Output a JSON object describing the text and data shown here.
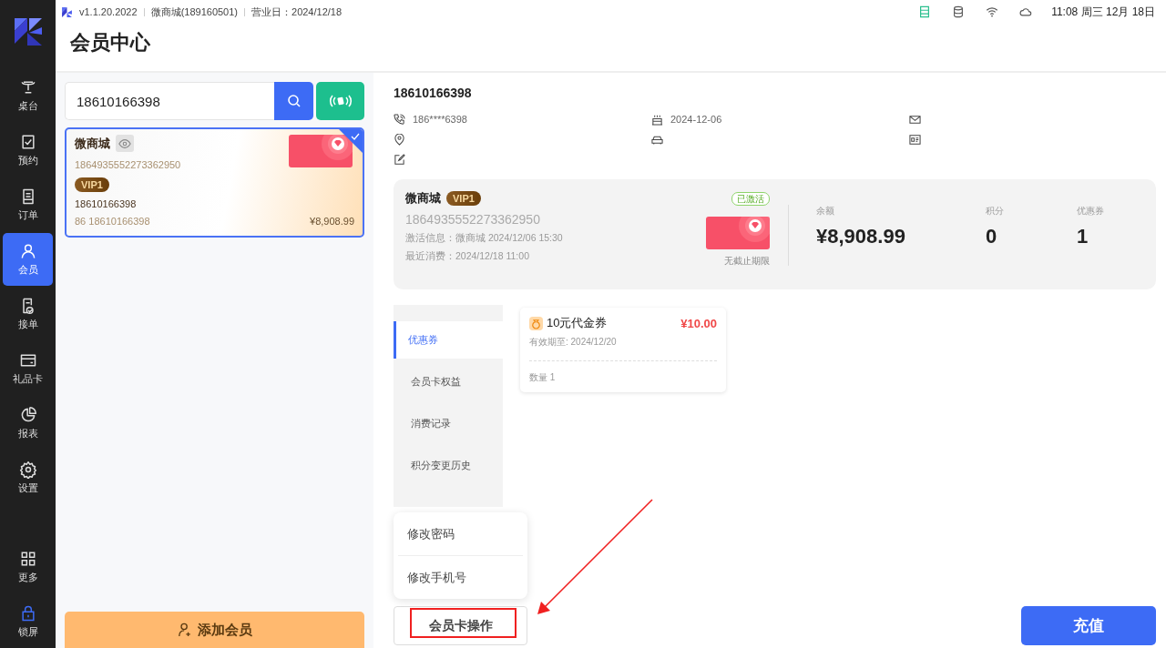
{
  "app_bar": {
    "version": "v1.1.20.2022",
    "store": "微商城(189160501)",
    "business_day": "营业日：2024/12/18",
    "clock": "11:08 周三 12月 18日"
  },
  "page_title": "会员中心",
  "sidebar": {
    "items": [
      {
        "label": "桌台",
        "selected": false
      },
      {
        "label": "预约",
        "selected": false
      },
      {
        "label": "订单",
        "selected": false
      },
      {
        "label": "会员",
        "selected": true
      },
      {
        "label": "接单",
        "selected": false
      },
      {
        "label": "礼品卡",
        "selected": false
      },
      {
        "label": "报表",
        "selected": false
      },
      {
        "label": "设置",
        "selected": false
      }
    ],
    "bottom_items": [
      {
        "label": "更多",
        "selected": false
      },
      {
        "label": "锁屏",
        "selected": false
      }
    ]
  },
  "search": {
    "value": "18610166398"
  },
  "member_cards": [
    {
      "name": "微商城",
      "card_no": "1864935552273362950",
      "level": "VIP1",
      "phone": "18610166398",
      "phone_full": "86 18610166398",
      "balance": "¥8,908.99",
      "selected": true
    }
  ],
  "add_member_button": "添加会员",
  "profile": {
    "title": "18610166398",
    "phone": "186****6398",
    "birthday": "2024-12-06"
  },
  "card_summary": {
    "name": "微商城",
    "level": "VIP1",
    "status": "已激活",
    "card_no": "1864935552273362950",
    "activation": "激活信息：微商城  2024/12/06 15:30",
    "last_spend": "最近消费：2024/12/18 11:00",
    "validity": "无截止期限",
    "stats": [
      {
        "label": "余额",
        "value": "¥8,908.99"
      },
      {
        "label": "积分",
        "value": "0"
      },
      {
        "label": "优惠券",
        "value": "1"
      }
    ]
  },
  "tabs": [
    {
      "label": "优惠券",
      "selected": true
    },
    {
      "label": "会员卡权益",
      "selected": false
    },
    {
      "label": "消费记录",
      "selected": false
    },
    {
      "label": "积分变更历史",
      "selected": false
    }
  ],
  "coupons": [
    {
      "name": "10元代金券",
      "amount": "¥10.00",
      "expiry": "有效期至: 2024/12/20",
      "quantity": "数量 1"
    }
  ],
  "card_actions_menu": [
    "修改密码",
    "修改手机号"
  ],
  "card_actions_button": "会员卡操作",
  "recharge_button": "充值"
}
